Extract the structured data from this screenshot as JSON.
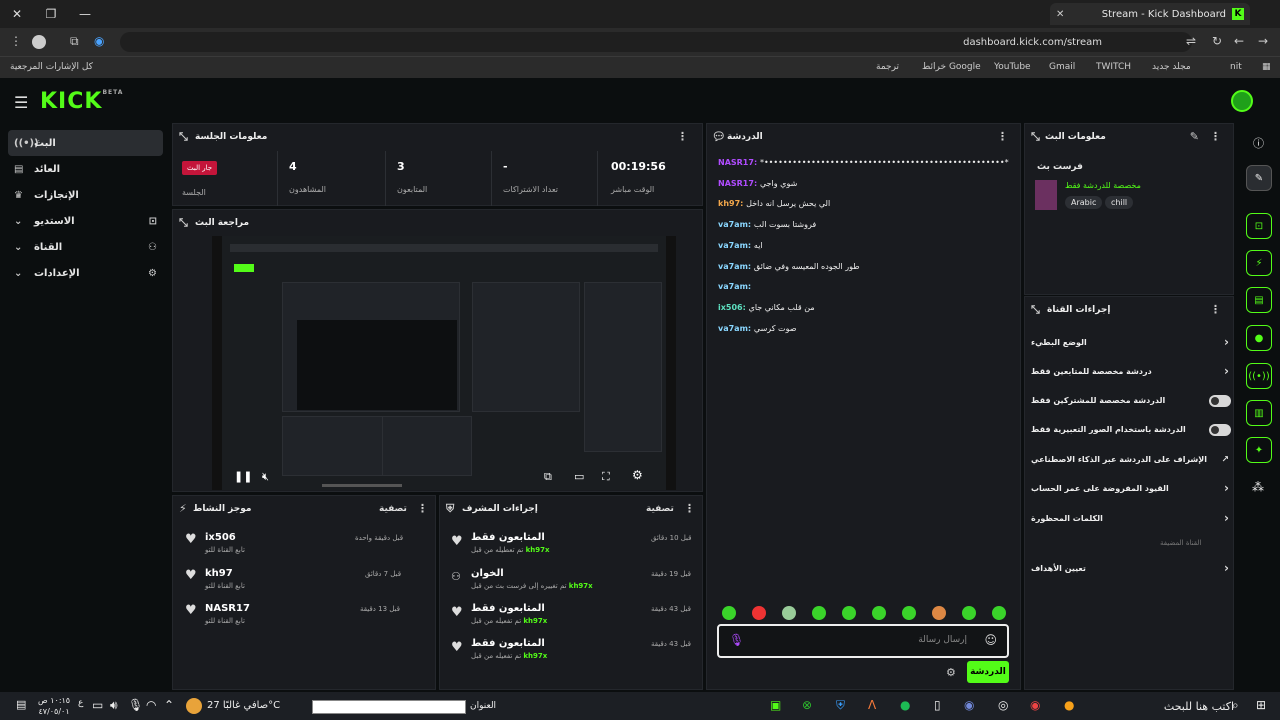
{
  "browser": {
    "tab_title": "Stream - Kick Dashboard",
    "url": "dashboard.kick.com/stream",
    "bookmarks": [
      "كل الإشارات المرجعية",
      "nit",
      "مجلد جديد",
      "TWITCH",
      "Gmail",
      "YouTube",
      "خرائط Google",
      "ترجمة"
    ]
  },
  "kick": {
    "logo": "KICK",
    "logo_sup": "BETA"
  },
  "sidebar": {
    "items": [
      {
        "label": "البث",
        "icon": "broadcast-icon"
      },
      {
        "label": "العائد",
        "icon": "wallet-icon"
      },
      {
        "label": "الإنجازات",
        "icon": "trophy-icon"
      },
      {
        "label": "الاستديو",
        "icon": "studio-icon"
      },
      {
        "label": "القناة",
        "icon": "channel-icon"
      },
      {
        "label": "الإعدادات",
        "icon": "gear-icon"
      }
    ]
  },
  "session": {
    "title": "معلومات الجلسة",
    "live_badge": "جار البث",
    "live_label": "الجلسة",
    "stats": [
      {
        "value": "00:19:56",
        "label": "الوقت مباشر"
      },
      {
        "value": "-",
        "label": "تعداد الاشتراكات"
      },
      {
        "value": "3",
        "label": "المتابعون"
      },
      {
        "value": "4",
        "label": "المشاهدون"
      }
    ]
  },
  "preview": {
    "title": "مراجعة البث"
  },
  "activity": {
    "title": "موجز النشاط",
    "filter": "تصفية",
    "items": [
      {
        "name": "ix506",
        "sub": "تابع القناة للتو",
        "time": "قبل دقيقة واحدة"
      },
      {
        "name": "kh97",
        "sub": "تابع القناة للتو",
        "time": "قبل 7 دقائق"
      },
      {
        "name": "NASR17",
        "sub": "تابع القناة للتو",
        "time": "قبل 13 دقيقة"
      }
    ]
  },
  "modactions": {
    "title": "إجراءات المشرف",
    "filter": "تصفية",
    "items": [
      {
        "title": "المتابعون فقط",
        "sub": "تم تعطيله من قبل",
        "user": "kh97x",
        "time": "قبل 10 دقائق"
      },
      {
        "title": "الخوان",
        "sub": "تم تغييره إلى فرست بث من قبل",
        "user": "kh97x",
        "time": "قبل 19 دقيقة"
      },
      {
        "title": "المتابعون فقط",
        "sub": "تم تفعيله من قبل",
        "user": "kh97x",
        "time": "قبل 43 دقيقة"
      },
      {
        "title": "المتابعون فقط",
        "sub": "تم تفعيله من قبل",
        "user": "kh97x",
        "time": "قبل 43 دقيقة"
      }
    ]
  },
  "chat": {
    "title": "الدردشة",
    "messages": [
      {
        "user": "NASR17",
        "color": "#b04cff",
        "text": "*•••••••••••••••••••••••••••••••••••••••••••••••••••*"
      },
      {
        "user": "NASR17",
        "color": "#b04cff",
        "text": "شوي واجي"
      },
      {
        "user": "kh97",
        "color": "#f2a74b",
        "text": "الي يحش يرسل انه داخل"
      },
      {
        "user": "va7am",
        "color": "#8ad7ff",
        "text": "فروشتا بسوت الب"
      },
      {
        "user": "va7am",
        "color": "#8ad7ff",
        "text": "ايه"
      },
      {
        "user": "va7am",
        "color": "#8ad7ff",
        "text": "طور الجوده المعيسه وفي ضائق"
      },
      {
        "user": "va7am",
        "color": "#8ad7ff",
        "text": ""
      },
      {
        "user": "ix506",
        "color": "#5de0c0",
        "text": "من قلب مكاني جاي"
      },
      {
        "user": "va7am",
        "color": "#8ad7ff",
        "text": "صوت كرسي"
      }
    ],
    "input_placeholder": "إرسال رسالة",
    "send_label": "الدردشة"
  },
  "streaminfo": {
    "title": "معلومات البث",
    "stream_title": "فرست بث",
    "category": "مخصصة للدردشة فقط",
    "tags": [
      "Arabic",
      "chill"
    ]
  },
  "channel_actions": {
    "title": "إجراءات القناة",
    "rows": [
      {
        "label": "الوضع البطيء",
        "control": "arrow"
      },
      {
        "label": "دردشة مخصصة للمتابعين فقط",
        "control": "arrow"
      },
      {
        "label": "الدردشة مخصصة للمشتركين فقط",
        "control": "toggle"
      },
      {
        "label": "الدردشة باستخدام الصور التعبيرية فقط",
        "control": "toggle"
      },
      {
        "label": "الإشراف على الدردشة عبر الذكاء الاصطناعي",
        "control": "link"
      },
      {
        "label": "القيود المفروضة على عمر الحساب",
        "control": "arrow"
      },
      {
        "label": "الكلمات المحظورة",
        "control": "arrow"
      }
    ],
    "section": "القناة المضيفة",
    "target_row": "تعيين الأهداف"
  },
  "taskbar": {
    "search": "اكتب هنا للبحث",
    "address_label": "العنوان",
    "weather": "صافي غالبًا  27°C",
    "time": "١٠:١٥ ص",
    "date": "٤٧/٠٥/٠١",
    "lang": "ع"
  },
  "colors": {
    "accent": "#53fc18",
    "live": "#c4153a",
    "panel": "#191b1f",
    "bg": "#0b0e0f"
  }
}
